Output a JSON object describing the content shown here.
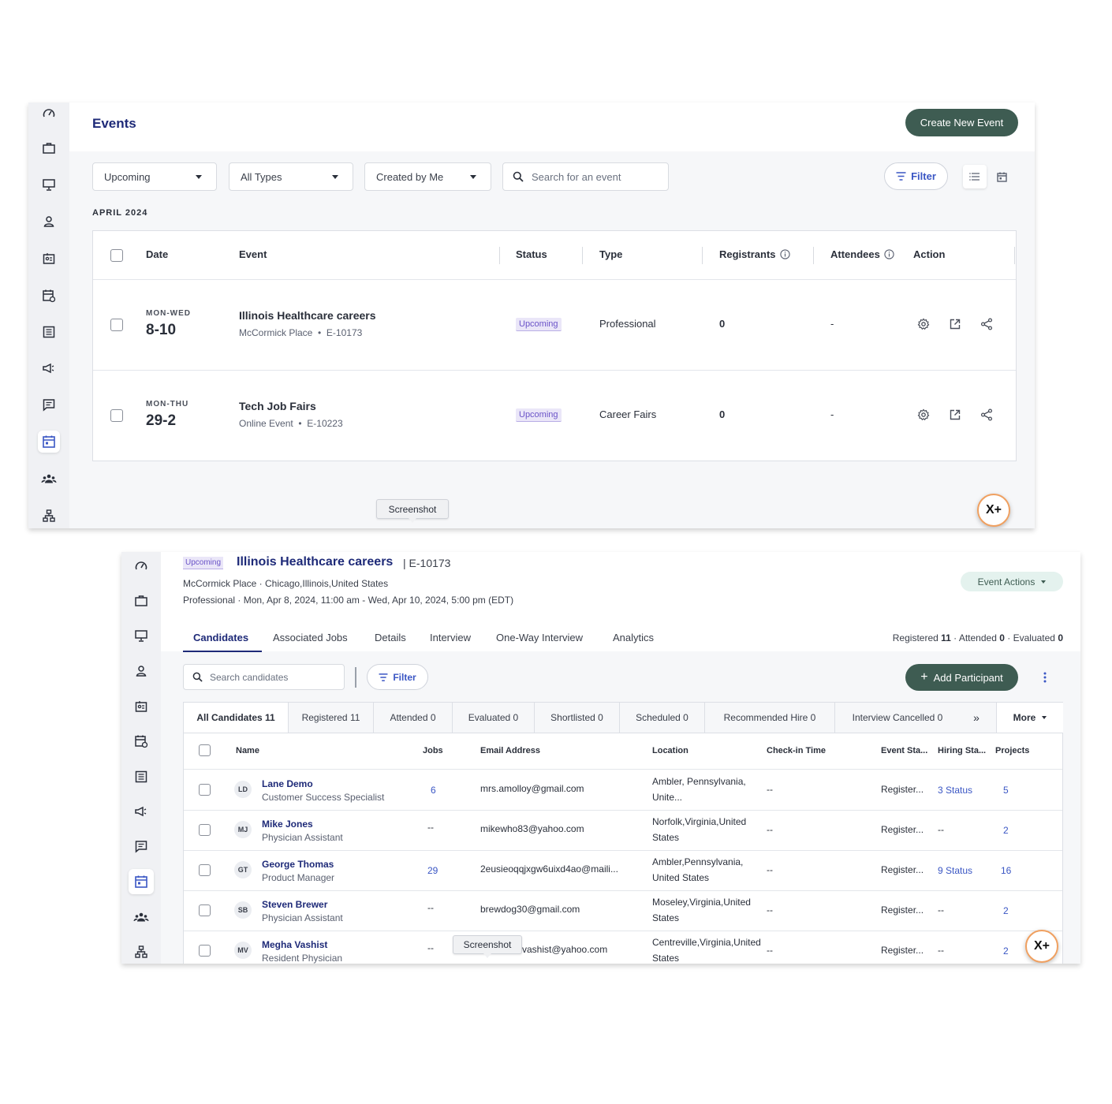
{
  "events_page": {
    "title": "Events",
    "create_button": "Create New Event",
    "filters": {
      "time": "Upcoming",
      "type": "All Types",
      "owner": "Created by Me",
      "search_placeholder": "Search for an event"
    },
    "filter_button": "Filter",
    "month_label": "APRIL 2024",
    "columns": [
      "Date",
      "Event",
      "Status",
      "Type",
      "Registrants",
      "Attendees",
      "Action"
    ],
    "rows": [
      {
        "day_range": "MON-WED",
        "days": "8-10",
        "title": "Illinois Healthcare careers",
        "location": "McCormick Place",
        "id": "E-10173",
        "status": "Upcoming",
        "type": "Professional",
        "registrants": "0",
        "attendees": "-"
      },
      {
        "day_range": "MON-THU",
        "days": "29-2",
        "title": "Tech Job Fairs",
        "location": "Online Event",
        "id": "E-10223",
        "status": "Upcoming",
        "type": "Career Fairs",
        "registrants": "0",
        "attendees": "-"
      }
    ],
    "tooltip": "Screenshot",
    "fab_label": "X+"
  },
  "event_detail": {
    "status_badge": "Upcoming",
    "title": "Illinois Healthcare careers",
    "id": "| E-10173",
    "location_line": "McCormick Place · Chicago,Illinois,United States",
    "schedule_line": "Professional · Mon, Apr 8, 2024, 11:00 am - Wed, Apr 10, 2024, 5:00 pm (EDT)",
    "actions_button": "Event Actions",
    "tabs": [
      "Candidates",
      "Associated Jobs",
      "Details",
      "Interview",
      "One-Way Interview",
      "Analytics"
    ],
    "counts": {
      "registered_label": "Registered",
      "registered": "11",
      "attended_label": "· Attended",
      "attended": "0",
      "evaluated_label": "· Evaluated",
      "evaluated": "0"
    },
    "search_placeholder": "Search candidates",
    "filter_button": "Filter",
    "add_button": "Add Participant",
    "status_tabs": [
      "All Candidates 11",
      "Registered 11",
      "Attended 0",
      "Evaluated 0",
      "Shortlisted 0",
      "Scheduled 0",
      "Recommended Hire 0",
      "Interview Cancelled 0"
    ],
    "more_button": "More",
    "columns": [
      "Name",
      "Jobs",
      "Email Address",
      "Location",
      "Check-in Time",
      "Event Sta...",
      "Hiring Sta...",
      "Projects"
    ],
    "candidates": [
      {
        "initials": "LD",
        "name": "Lane Demo",
        "role": "Customer Success Specialist",
        "jobs": "6",
        "email": "mrs.amolloy@gmail.com",
        "location": "Ambler, Pennsylvania, Unite...",
        "checkin": "--",
        "event_status": "Register...",
        "hiring_status": "3 Status",
        "projects": "5"
      },
      {
        "initials": "MJ",
        "name": "Mike Jones",
        "role": "Physician Assistant",
        "jobs": "--",
        "email": "mikewho83@yahoo.com",
        "location": "Norfolk,Virginia,United States",
        "checkin": "--",
        "event_status": "Register...",
        "hiring_status": "--",
        "projects": "2"
      },
      {
        "initials": "GT",
        "name": "George Thomas",
        "role": "Product Manager",
        "jobs": "29",
        "email": "2eusieoqqjxgw6uixd4ao@maili...",
        "location": "Ambler,Pennsylvania, United States",
        "checkin": "--",
        "event_status": "Register...",
        "hiring_status": "9 Status",
        "projects": "16"
      },
      {
        "initials": "SB",
        "name": "Steven Brewer",
        "role": "Physician Assistant",
        "jobs": "--",
        "email": "brewdog30@gmail.com",
        "location": "Moseley,Virginia,United States",
        "checkin": "--",
        "event_status": "Register...",
        "hiring_status": "--",
        "projects": "2"
      },
      {
        "initials": "MV",
        "name": "Megha Vashist",
        "role": "Resident Physician",
        "jobs": "--",
        "email": "vashist@yahoo.com",
        "location": "Centreville,Virginia,United States",
        "checkin": "--",
        "event_status": "Register...",
        "hiring_status": "--",
        "projects": "2"
      }
    ],
    "tooltip": "Screenshot",
    "fab_label": "X+"
  },
  "colors": {
    "brand_green": "#3e5c52",
    "title_navy": "#1e2a78",
    "link_blue": "#3a56c4",
    "badge_purple": "#6b54c8"
  }
}
